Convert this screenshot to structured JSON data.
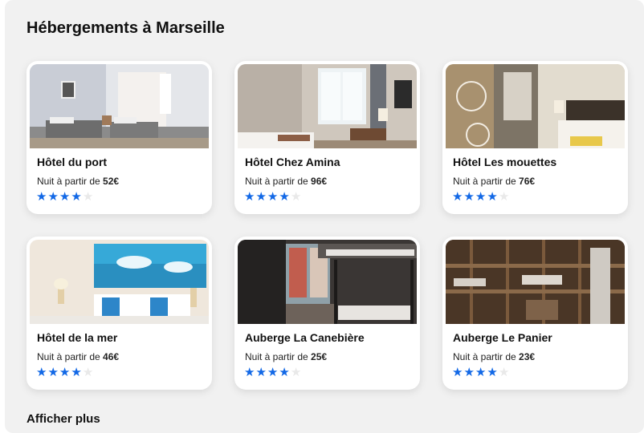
{
  "page": {
    "title": "Hébergements à Marseille",
    "show_more_label": "Afficher plus"
  },
  "colors": {
    "star_filled": "#1268e6",
    "star_empty": "#e9e9e9",
    "panel_bg": "#f1f1f1"
  },
  "hotels": [
    {
      "name": "Hôtel du port",
      "price_prefix": "Nuit à partir de ",
      "price": "52€",
      "rating": 4,
      "rating_max": 5
    },
    {
      "name": "Hôtel Chez Amina",
      "price_prefix": "Nuit à partir de ",
      "price": "96€",
      "rating": 4,
      "rating_max": 5
    },
    {
      "name": "Hôtel Les mouettes",
      "price_prefix": "Nuit à partir de ",
      "price": "76€",
      "rating": 4,
      "rating_max": 5
    },
    {
      "name": "Hôtel de la mer",
      "price_prefix": "Nuit à partir de ",
      "price": "46€",
      "rating": 4,
      "rating_max": 5
    },
    {
      "name": "Auberge La Canebière",
      "price_prefix": "Nuit à partir de ",
      "price": "25€",
      "rating": 4,
      "rating_max": 5
    },
    {
      "name": "Auberge Le Panier",
      "price_prefix": "Nuit à partir de ",
      "price": "23€",
      "rating": 4,
      "rating_max": 5
    }
  ]
}
